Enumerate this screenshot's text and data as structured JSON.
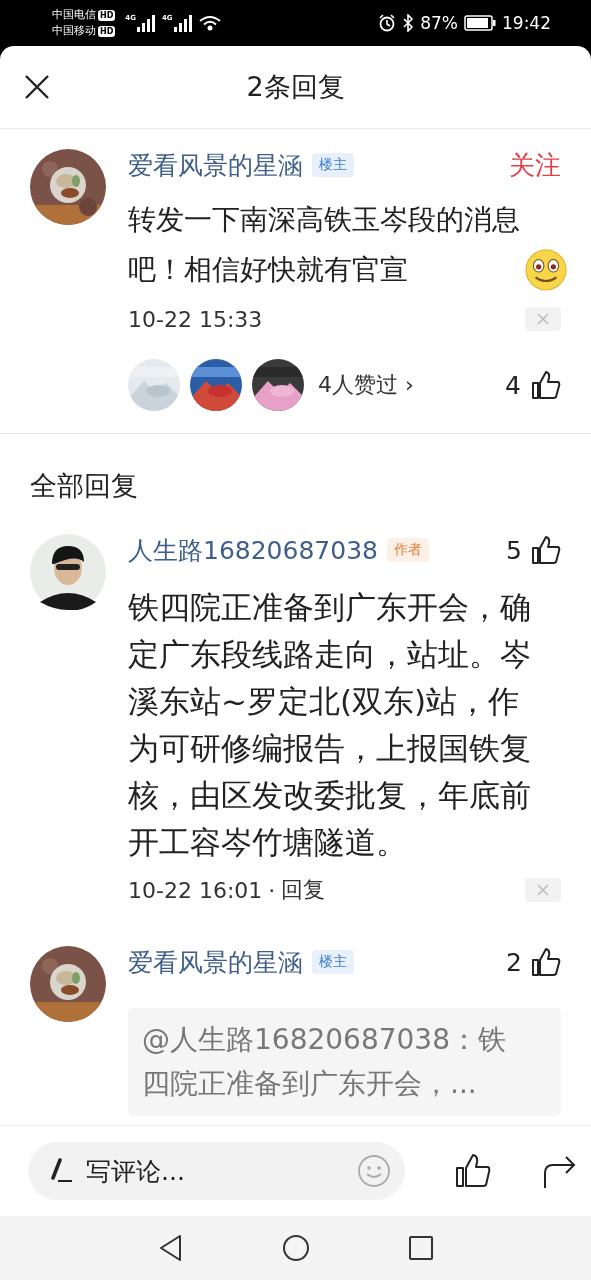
{
  "status_bar": {
    "carriers": [
      {
        "name": "中国电信",
        "hd": "HD",
        "network": "4G"
      },
      {
        "name": "中国移动",
        "hd": "HD",
        "network": "4G"
      }
    ],
    "battery": "87%",
    "time": "19:42"
  },
  "header": {
    "title": "2条回复"
  },
  "post": {
    "author": "爱看风景的星涵",
    "badge": {
      "kind": "op",
      "label": "楼主"
    },
    "follow": "关注",
    "text": "转发一下南深高铁玉岑段的消息吧！相信好快就有官宣",
    "time": "10-22 15:33",
    "likers_label": "4人赞过",
    "likers_arrow": "›",
    "likes": "4"
  },
  "section_title": "全部回复",
  "replies": [
    {
      "author": "人生路16820687038",
      "avatar": {
        "kind": "person"
      },
      "badge": {
        "kind": "author",
        "label": "作者"
      },
      "likes": "5",
      "text": "铁四院正准备到广东开会，确定广东段线路走向，站址。岑溪东站~罗定北(双东)站，作为可研修编报告，上报国铁复核，由区发改委批复，年底前开工容岑竹塘隧道。",
      "time": "10-22 16:01",
      "separator": "·",
      "reply_label": "回复"
    },
    {
      "author": "爱看风景的星涵",
      "badge": {
        "kind": "op",
        "label": "楼主"
      },
      "likes": "2",
      "quote": "@人生路16820687038：铁四院正准备到广东开会，..."
    }
  ],
  "composer": {
    "placeholder": "写评论..."
  }
}
